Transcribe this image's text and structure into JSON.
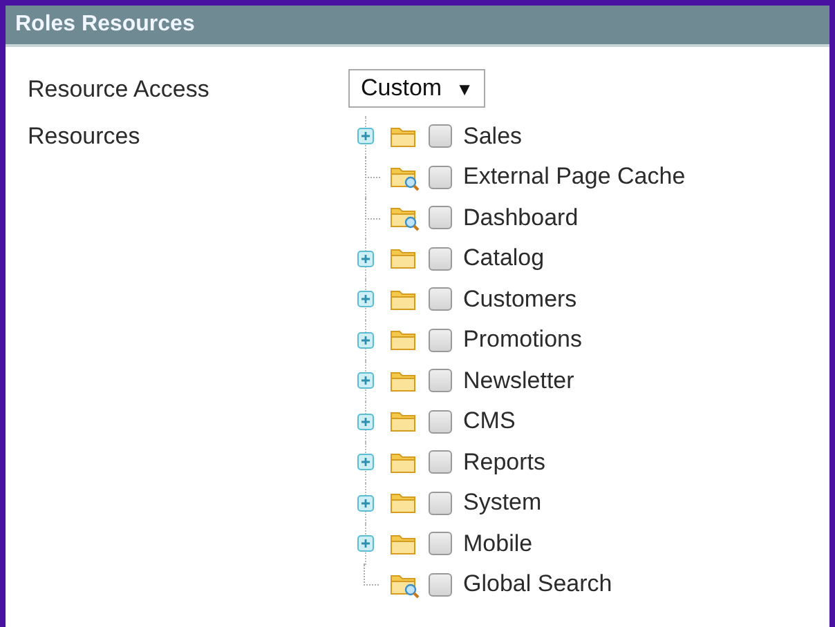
{
  "panel": {
    "title": "Roles Resources"
  },
  "form": {
    "resource_access": {
      "label": "Resource Access",
      "value": "Custom",
      "arrow": "▼"
    },
    "resources_label": "Resources"
  },
  "tree": [
    {
      "kind": "folder",
      "label": "Sales",
      "checked": false
    },
    {
      "kind": "leaf",
      "label": "External Page Cache",
      "checked": false
    },
    {
      "kind": "leaf",
      "label": "Dashboard",
      "checked": false
    },
    {
      "kind": "folder",
      "label": "Catalog",
      "checked": false
    },
    {
      "kind": "folder",
      "label": "Customers",
      "checked": false
    },
    {
      "kind": "folder",
      "label": "Promotions",
      "checked": false
    },
    {
      "kind": "folder",
      "label": "Newsletter",
      "checked": false
    },
    {
      "kind": "folder",
      "label": "CMS",
      "checked": false
    },
    {
      "kind": "folder",
      "label": "Reports",
      "checked": false
    },
    {
      "kind": "folder",
      "label": "System",
      "checked": false
    },
    {
      "kind": "folder",
      "label": "Mobile",
      "checked": false
    },
    {
      "kind": "leaf",
      "label": "Global Search",
      "checked": false
    }
  ]
}
